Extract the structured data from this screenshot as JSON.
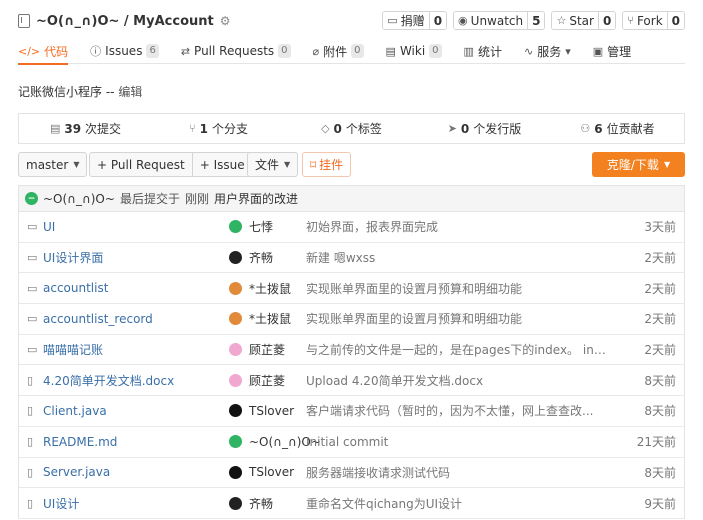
{
  "repo": {
    "title": "~O(∩_∩)O~ / MyAccount"
  },
  "actions": [
    {
      "icon": "donate-icon",
      "label": "捐赠",
      "count": "0"
    },
    {
      "icon": "eye-icon",
      "label": "Unwatch",
      "count": "5"
    },
    {
      "icon": "star-icon",
      "label": "Star",
      "count": "0"
    },
    {
      "icon": "fork-icon",
      "label": "Fork",
      "count": "0"
    }
  ],
  "tabs": [
    {
      "icon": "code-icon",
      "label": "代码",
      "badge": ""
    },
    {
      "icon": "issue-icon",
      "label": "Issues",
      "badge": "6"
    },
    {
      "icon": "pull-request-icon",
      "label": "Pull Requests",
      "badge": "0"
    },
    {
      "icon": "attachment-icon",
      "label": "附件",
      "badge": "0"
    },
    {
      "icon": "wiki-icon",
      "label": "Wiki",
      "badge": "0"
    },
    {
      "icon": "chart-icon",
      "label": "统计",
      "badge": ""
    },
    {
      "icon": "service-icon",
      "label": "服务",
      "badge": ""
    },
    {
      "icon": "manage-icon",
      "label": "管理",
      "badge": ""
    }
  ],
  "description": {
    "text": "记账微信小程序 --",
    "edit": "编辑"
  },
  "stats": [
    {
      "icon": "commit-icon",
      "num": "39",
      "label": "次提交"
    },
    {
      "icon": "branch-icon",
      "num": "1",
      "label": "个分支"
    },
    {
      "icon": "tag-icon",
      "num": "0",
      "label": "个标签"
    },
    {
      "icon": "release-icon",
      "num": "0",
      "label": "个发行版"
    },
    {
      "icon": "contributor-icon",
      "num": "6",
      "label": "位贡献者"
    }
  ],
  "toolbar": {
    "branch": "master",
    "pull_request": "+ Pull Request",
    "issue": "+ Issue",
    "file": "文件",
    "widget": "挂件",
    "clone": "克隆/下载"
  },
  "last_commit": {
    "author": "~O(∩_∩)O~",
    "text": "最后提交于",
    "time": "刚刚",
    "message": "用户界面的改进"
  },
  "files": [
    {
      "type": "folder",
      "name": "UI",
      "author": "七悸",
      "avatar_color": "#2eb462",
      "message": "初始界面，报表界面完成",
      "time": "3天前"
    },
    {
      "type": "folder",
      "name": "UI设计界面",
      "author": "齐畅",
      "avatar_color": "#222222",
      "message": "新建 嗯wxss",
      "time": "2天前"
    },
    {
      "type": "folder",
      "name": "accountlist",
      "author": "*土拨鼠",
      "avatar_color": "#e08a3a",
      "message": "实现账单界面里的设置月预算和明细功能",
      "time": "2天前"
    },
    {
      "type": "folder",
      "name": "accountlist_record",
      "author": "*土拨鼠",
      "avatar_color": "#e08a3a",
      "message": "实现账单界面里的设置月预算和明细功能",
      "time": "2天前"
    },
    {
      "type": "folder",
      "name": "喵喵喵记账",
      "author": "顾芷菱",
      "avatar_color": "#f0a8d0",
      "message": "与之前传的文件是一起的，是在pages下的index。 inp...",
      "time": "2天前"
    },
    {
      "type": "file",
      "name": "4.20简单开发文档.docx",
      "author": "顾芷菱",
      "avatar_color": "#f0a8d0",
      "message": "Upload 4.20简单开发文档.docx",
      "time": "8天前"
    },
    {
      "type": "file",
      "name": "Client.java",
      "author": "TSlover",
      "avatar_color": "#111111",
      "message": "客户端请求代码（暂时的，因为不太懂，网上查查改...",
      "time": "8天前"
    },
    {
      "type": "file",
      "name": "README.md",
      "author": "~O(∩_∩)O~",
      "avatar_color": "#2eb462",
      "message": "Initial commit",
      "time": "21天前"
    },
    {
      "type": "file",
      "name": "Server.java",
      "author": "TSlover",
      "avatar_color": "#111111",
      "message": "服务器端接收请求测试代码",
      "time": "8天前"
    },
    {
      "type": "file",
      "name": "UI设计",
      "author": "齐畅",
      "avatar_color": "#222222",
      "message": "重命名文件qichang为UI设计",
      "time": "9天前"
    }
  ],
  "colors": {
    "accent": "#f36c21",
    "clone_button": "#f4811f",
    "link": "#3a6fa8"
  }
}
